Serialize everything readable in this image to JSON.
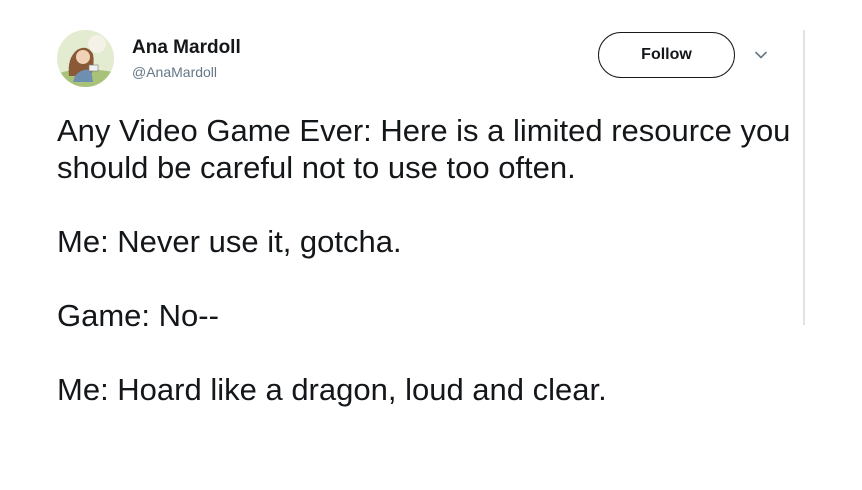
{
  "tweet": {
    "author": {
      "name": "Ana Mardoll",
      "handle": "@AnaMardoll",
      "avatar_icon": "profile-avatar"
    },
    "follow_button": {
      "label": "Follow"
    },
    "more_menu_icon": "chevron-down-icon",
    "paragraphs": [
      "Any Video Game Ever: Here is a limited resource you should be careful not to use too often.",
      "Me: Never use it, gotcha.",
      "Game: No--",
      "Me: Hoard like a dragon, loud and clear."
    ]
  },
  "colors": {
    "text": "#14171a",
    "muted": "#657786",
    "border": "#1a1a1a",
    "divider": "#e1e3e6"
  }
}
